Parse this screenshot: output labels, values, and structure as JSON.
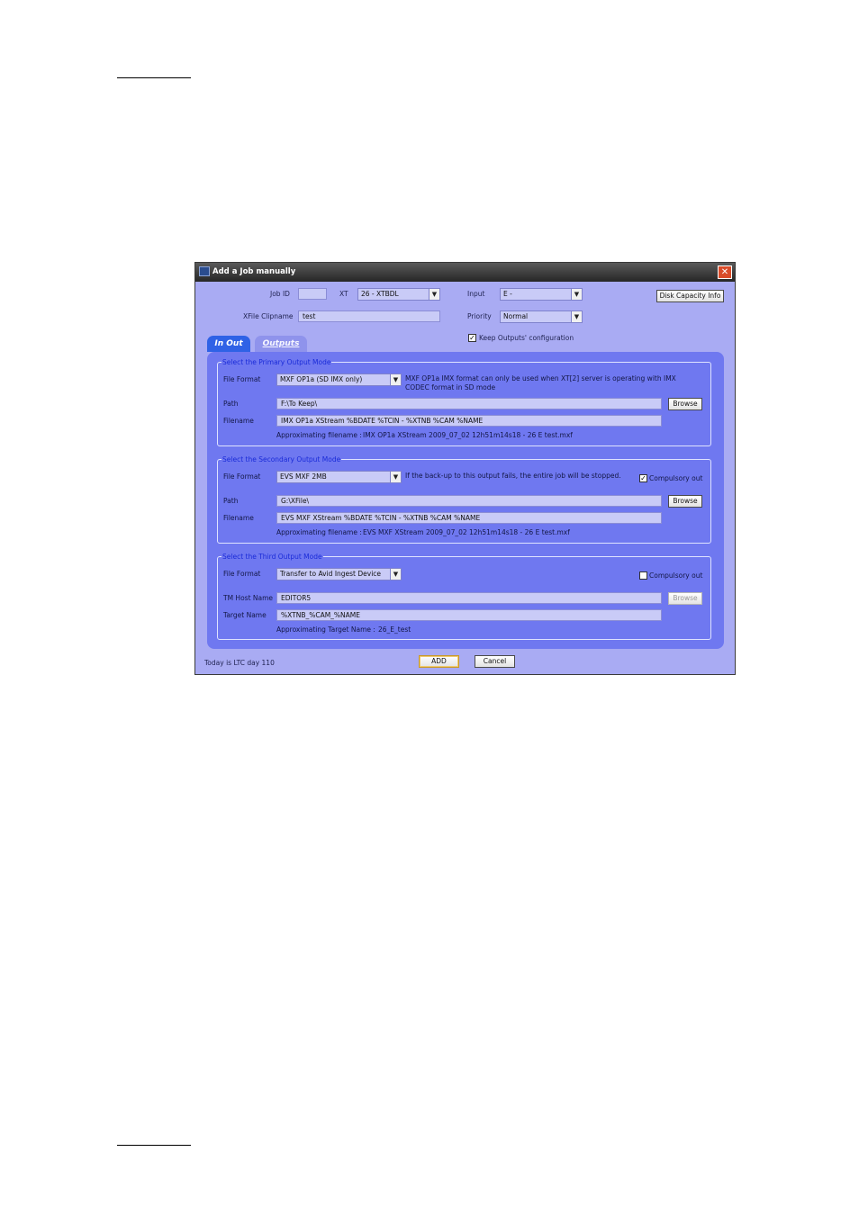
{
  "window": {
    "title": "Add a Job manually",
    "close_symbol": "✕",
    "icon": "app-icon"
  },
  "top_form": {
    "job_id_label": "Job ID",
    "job_id_value": "",
    "xt_label": "XT",
    "xt_value": "26 - XTBDL",
    "input_label": "Input",
    "input_value": "E -",
    "xfile_clipname_label": "XFile Clipname",
    "xfile_clipname_value": "test",
    "priority_label": "Priority",
    "priority_value": "Normal",
    "disk_capacity_label": "Disk Capacity Info",
    "keep_outputs_label": "Keep Outputs' configuration",
    "keep_outputs_checked": true
  },
  "tabs": [
    {
      "label": "In Out",
      "active": true
    },
    {
      "label": "Outputs",
      "active": false
    }
  ],
  "primary": {
    "legend": "Select the Primary Output Mode",
    "file_format_label": "File Format",
    "file_format_value": "MXF OP1a (SD IMX only)",
    "note": "MXF OP1a IMX format can only be used when XT[2] server is operating with IMX CODEC format in SD mode",
    "path_label": "Path",
    "path_value": "F:\\To Keep\\",
    "browse_label": "Browse",
    "filename_label": "Filename",
    "filename_value": "IMX OP1a XStream %BDATE %TCIN - %XTNB %CAM %NAME",
    "approx_label": "Approximating filename :",
    "approx_value": "IMX OP1a XStream 2009_07_02 12h51m14s18 - 26 E test.mxf"
  },
  "secondary": {
    "legend": "Select the Secondary Output Mode",
    "file_format_label": "File Format",
    "file_format_value": "EVS MXF 2MB",
    "note": "If the back-up to this output fails, the entire job will be stopped.",
    "compulsory_label": "Compulsory out",
    "compulsory_checked": true,
    "path_label": "Path",
    "path_value": "G:\\XFile\\",
    "browse_label": "Browse",
    "filename_label": "Filename",
    "filename_value": "EVS MXF XStream %BDATE %TCIN - %XTNB %CAM %NAME",
    "approx_label": "Approximating filename :",
    "approx_value": "EVS MXF XStream 2009_07_02 12h51m14s18 - 26 E test.mxf"
  },
  "third": {
    "legend": "Select the Third Output Mode",
    "file_format_label": "File Format",
    "file_format_value": "Transfer to Avid Ingest Device",
    "compulsory_label": "Compulsory out",
    "compulsory_checked": false,
    "tm_host_label": "TM Host Name",
    "tm_host_value": "EDITOR5",
    "browse_label": "Browse",
    "target_name_label": "Target Name",
    "target_name_value": "%XTNB_%CAM_%NAME",
    "approx_label": "Approximating Target Name :",
    "approx_value": "26_E_test"
  },
  "footer": {
    "ltc_day_text": "Today is LTC day 110",
    "add_label": "ADD",
    "cancel_label": "Cancel"
  },
  "glyphs": {
    "check": "✓",
    "dropdown": "▼"
  }
}
